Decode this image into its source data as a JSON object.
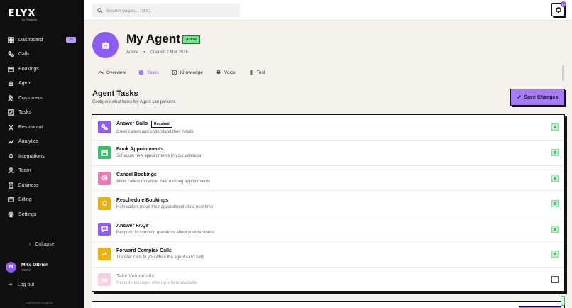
{
  "brand": {
    "name": "ELYX",
    "tagline": "by PregLink",
    "footer": "a service by PregLink"
  },
  "search": {
    "placeholder": "Search pages... (⌘K)"
  },
  "notifications": {
    "count": "9+"
  },
  "sidebar": {
    "items": [
      {
        "label": "Dashboard",
        "icon": "grid-icon",
        "badge": "35"
      },
      {
        "label": "Calls",
        "icon": "phone-icon"
      },
      {
        "label": "Bookings",
        "icon": "calendar-icon"
      },
      {
        "label": "Agent",
        "icon": "robot-icon"
      },
      {
        "label": "Customers",
        "icon": "users-icon"
      },
      {
        "label": "Tasks",
        "icon": "checkbox-icon"
      },
      {
        "label": "Restaurant",
        "icon": "utensils-icon"
      },
      {
        "label": "Analytics",
        "icon": "chart-icon"
      },
      {
        "label": "Integrations",
        "icon": "plug-icon"
      },
      {
        "label": "Team",
        "icon": "team-icon"
      },
      {
        "label": "Business",
        "icon": "building-icon"
      },
      {
        "label": "Billing",
        "icon": "card-icon"
      },
      {
        "label": "Settings",
        "icon": "gear-icon"
      }
    ],
    "collapse_label": "Collapse",
    "user": {
      "initial": "M",
      "name": "Mike OBrien",
      "role": "owner"
    },
    "logout_label": "Log out"
  },
  "agent": {
    "name": "My Agent",
    "status": "Active",
    "voice": "Aoede",
    "created": "Created 2 Mar 2026"
  },
  "tabs": [
    {
      "label": "Overview",
      "icon": "gauge-icon"
    },
    {
      "label": "Tasks",
      "icon": "gear-icon",
      "active": true
    },
    {
      "label": "Knowledge",
      "icon": "info-icon"
    },
    {
      "label": "Voice",
      "icon": "mic-icon"
    },
    {
      "label": "Test",
      "icon": "test-tube-icon"
    }
  ],
  "section": {
    "title": "Agent Tasks",
    "subtitle": "Configure what tasks My Agent can perform.",
    "save_label": "Save Changes"
  },
  "tasks": [
    {
      "name": "Answer Calls",
      "desc": "Greet callers and understand their needs",
      "required": "Required",
      "enabled": true,
      "color": "#8b5cf6",
      "icon": "phone-icon"
    },
    {
      "name": "Book Appointments",
      "desc": "Schedule new appointments in your calendar",
      "enabled": true,
      "color": "#34c06a",
      "icon": "calendar-icon"
    },
    {
      "name": "Cancel Bookings",
      "desc": "Allow callers to cancel their existing appointments",
      "enabled": true,
      "color": "#f07ab0",
      "icon": "ban-icon"
    },
    {
      "name": "Reschedule Bookings",
      "desc": "Help callers move their appointments to a new time",
      "enabled": true,
      "color": "#f0b000",
      "icon": "refresh-icon"
    },
    {
      "name": "Answer FAQs",
      "desc": "Respond to common questions about your business",
      "enabled": true,
      "color": "#8b5cf6",
      "icon": "message-icon"
    },
    {
      "name": "Forward Complex Calls",
      "desc": "Transfer calls to you when the agent can't help",
      "enabled": true,
      "color": "#f0b000",
      "icon": "forward-icon"
    },
    {
      "name": "Take Voicemails",
      "desc": "Record messages when you're unavailable",
      "enabled": false,
      "color": "#f07ab0",
      "icon": "voicemail-icon"
    }
  ]
}
